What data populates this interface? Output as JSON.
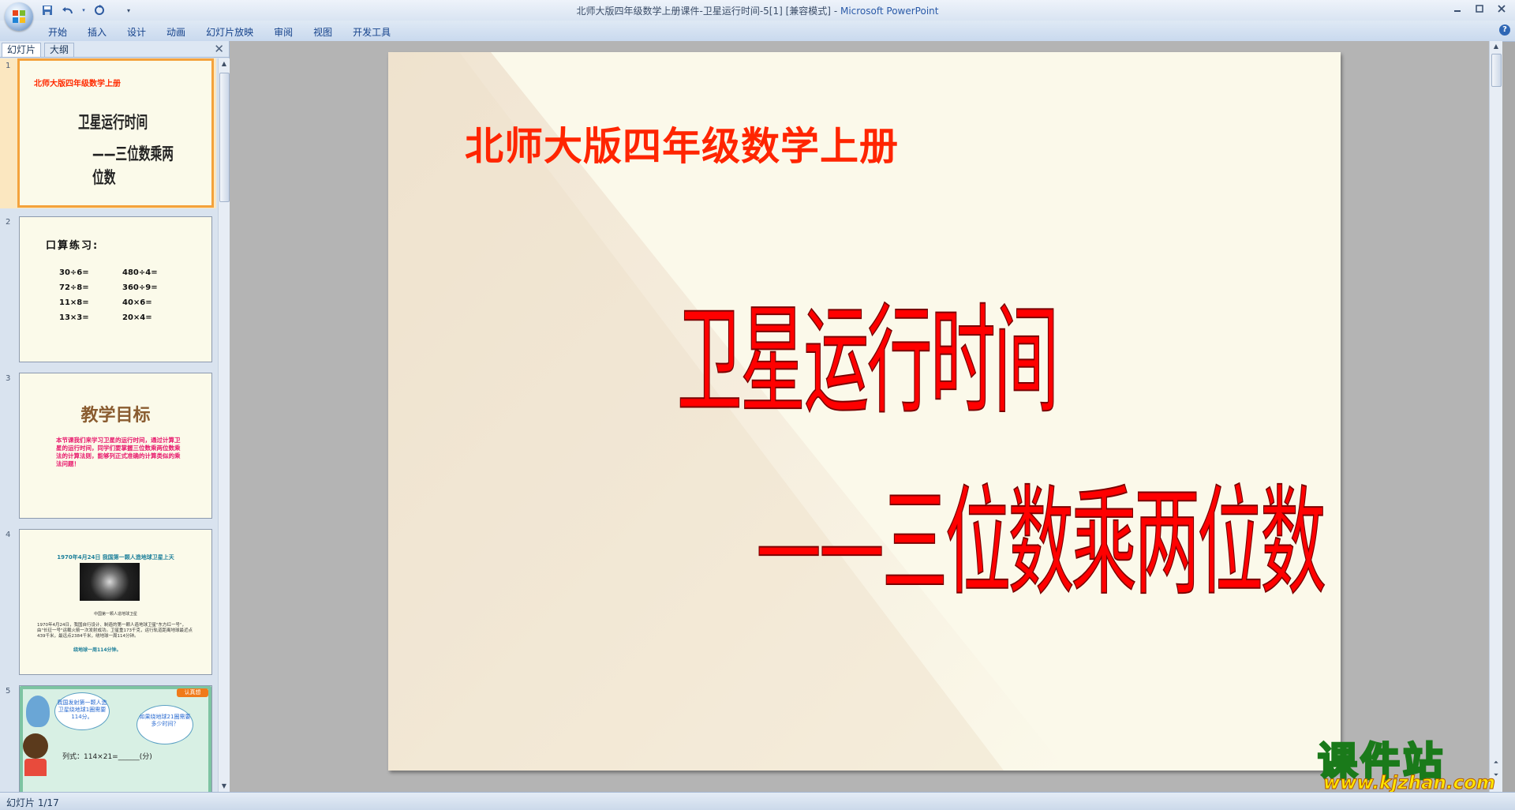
{
  "window": {
    "title": "北师大版四年级数学上册课件-卫星运行时间-5[1] [兼容模式]",
    "separator": " - ",
    "app_name": "Microsoft PowerPoint",
    "help": "?"
  },
  "quick_access": [
    "save-icon",
    "undo-icon",
    "redo-icon",
    "customize-icon"
  ],
  "ribbon": {
    "tabs": [
      {
        "label": "开始"
      },
      {
        "label": "插入"
      },
      {
        "label": "设计"
      },
      {
        "label": "动画"
      },
      {
        "label": "幻灯片放映"
      },
      {
        "label": "审阅"
      },
      {
        "label": "视图"
      },
      {
        "label": "开发工具"
      }
    ]
  },
  "left_pane": {
    "tabs": [
      "幻灯片",
      "大纲"
    ],
    "close": "✕",
    "thumbnails": [
      {
        "number": "1",
        "header": "北师大版四年级数学上册",
        "title": "卫星运行时间",
        "subtitle": "——三位数乘两位数"
      },
      {
        "number": "2",
        "title": "口算练习:",
        "problems": [
          "30÷6=",
          "480÷4=",
          "72÷8=",
          "360÷9=",
          "11×8=",
          "40×6=",
          "13×3=",
          "20×4="
        ]
      },
      {
        "number": "3",
        "title": "教学目标",
        "text": "本节课我们来学习卫星的运行时间，通过计算卫星的运行时间，同学们要掌握三位数乘两位数乘法的计算法则，能够列正式准确的计算类似的乘法问题！"
      },
      {
        "number": "4",
        "caption": "1970年4月24日 我国第一颗人造地球卫星上天",
        "photo_caption": "中国第一颗人造地球卫星",
        "text": "1970年4月24日，我国自行设计、制造的第一颗人造地球卫星\"东方红一号\"，由\"长征一号\"运载火箭一次发射成功。卫星重173千克，运行轨道距离地球最近点439千米，最远点2384千米，绕地球一周114分钟。",
        "highlight": "绕地球一周114分钟。"
      },
      {
        "number": "5",
        "badge": "认真想",
        "bubble1": "我国发射第一颗人造卫星绕地球1圈需要114分。",
        "bubble2": "如果绕地球21圈需要多少时间？",
        "equation": "列式：114×21=______(分)"
      }
    ]
  },
  "slide": {
    "header": "北师大版四年级数学上册",
    "title": "卫星运行时间",
    "subtitle": "——三位数乘两位数"
  },
  "watermark": {
    "text": "课件站",
    "url": "www.kjzhan.com"
  },
  "status_bar": {
    "slide_count": "幻灯片 1/17"
  },
  "colors": {
    "slide_bg": "#fbf9ea",
    "header_red": "#ff2500",
    "title_red": "#ff0000",
    "selection_orange": "#f4a23c"
  }
}
